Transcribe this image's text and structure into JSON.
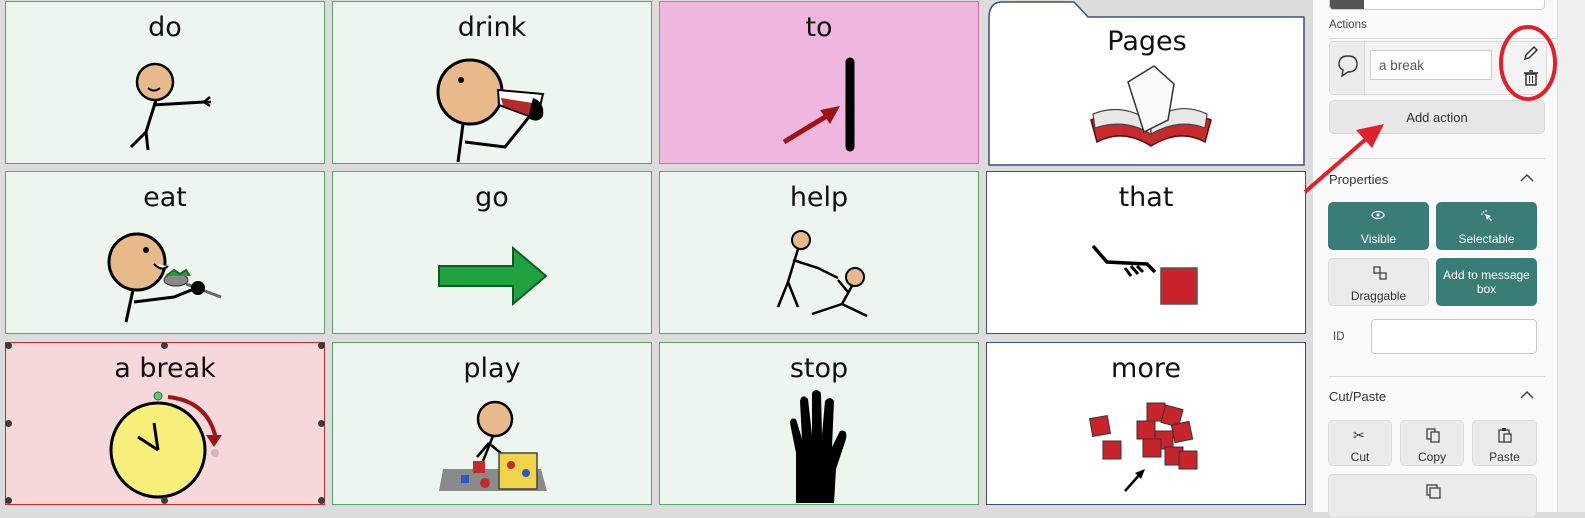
{
  "grid": {
    "cells": [
      {
        "label": "do"
      },
      {
        "label": "drink"
      },
      {
        "label": "to"
      },
      {
        "label": "Pages"
      },
      {
        "label": "eat"
      },
      {
        "label": "go"
      },
      {
        "label": "help"
      },
      {
        "label": "that"
      },
      {
        "label": "a break"
      },
      {
        "label": "play"
      },
      {
        "label": "stop"
      },
      {
        "label": "more"
      }
    ]
  },
  "panel": {
    "actions_label": "Actions",
    "action_value": "a break",
    "add_action_label": "Add action",
    "properties_title": "Properties",
    "visible_label": "Visible",
    "selectable_label": "Selectable",
    "draggable_label": "Draggable",
    "add_to_message_box_label": "Add to message box",
    "id_label": "ID",
    "id_value": "",
    "cutpaste_title": "Cut/Paste",
    "cut_label": "Cut",
    "copy_label": "Copy",
    "paste_label": "Paste"
  },
  "colors": {
    "accent_teal": "#3a7d76",
    "annotation_red": "#e0202a",
    "cell_green": "#edf6ee",
    "cell_pink": "#efb6df",
    "cell_selected": "#f6d8da"
  }
}
